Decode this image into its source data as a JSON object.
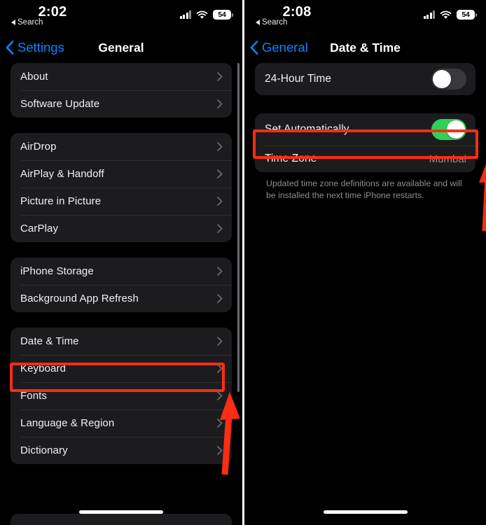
{
  "left": {
    "status": {
      "time": "2:02",
      "back_label": "Search",
      "battery": "54",
      "signal_icon": "cellular-signal-icon",
      "wifi_icon": "wifi-icon",
      "battery_icon": "battery-icon"
    },
    "nav": {
      "back_label": "Settings",
      "title": "General"
    },
    "groups": [
      {
        "rows": [
          {
            "label": "About",
            "accessory": "chevron"
          },
          {
            "label": "Software Update",
            "accessory": "chevron"
          }
        ]
      },
      {
        "rows": [
          {
            "label": "AirDrop",
            "accessory": "chevron"
          },
          {
            "label": "AirPlay & Handoff",
            "accessory": "chevron"
          },
          {
            "label": "Picture in Picture",
            "accessory": "chevron"
          },
          {
            "label": "CarPlay",
            "accessory": "chevron"
          }
        ]
      },
      {
        "rows": [
          {
            "label": "iPhone Storage",
            "accessory": "chevron"
          },
          {
            "label": "Background App Refresh",
            "accessory": "chevron"
          }
        ]
      },
      {
        "rows": [
          {
            "label": "Date & Time",
            "accessory": "chevron",
            "highlighted": true
          },
          {
            "label": "Keyboard",
            "accessory": "chevron"
          },
          {
            "label": "Fonts",
            "accessory": "chevron"
          },
          {
            "label": "Language & Region",
            "accessory": "chevron"
          },
          {
            "label": "Dictionary",
            "accessory": "chevron"
          }
        ]
      }
    ]
  },
  "right": {
    "status": {
      "time": "2:08",
      "back_label": "Search",
      "battery": "54",
      "signal_icon": "cellular-signal-icon",
      "wifi_icon": "wifi-icon",
      "battery_icon": "battery-icon"
    },
    "nav": {
      "back_label": "General",
      "title": "Date & Time"
    },
    "rows": {
      "hour24_label": "24-Hour Time",
      "hour24_state": "off",
      "set_auto_label": "Set Automatically",
      "set_auto_state": "on",
      "time_zone_label": "Time Zone",
      "time_zone_value": "Mumbai"
    },
    "footnote": "Updated time zone definitions are available and will be installed the next time iPhone restarts."
  },
  "annotation": {
    "color": "#fc2d13",
    "left_box_target": "Date & Time",
    "right_box_target": "Set Automatically",
    "left_arrow": "up-arrow",
    "right_arrow": "up-arrow"
  }
}
